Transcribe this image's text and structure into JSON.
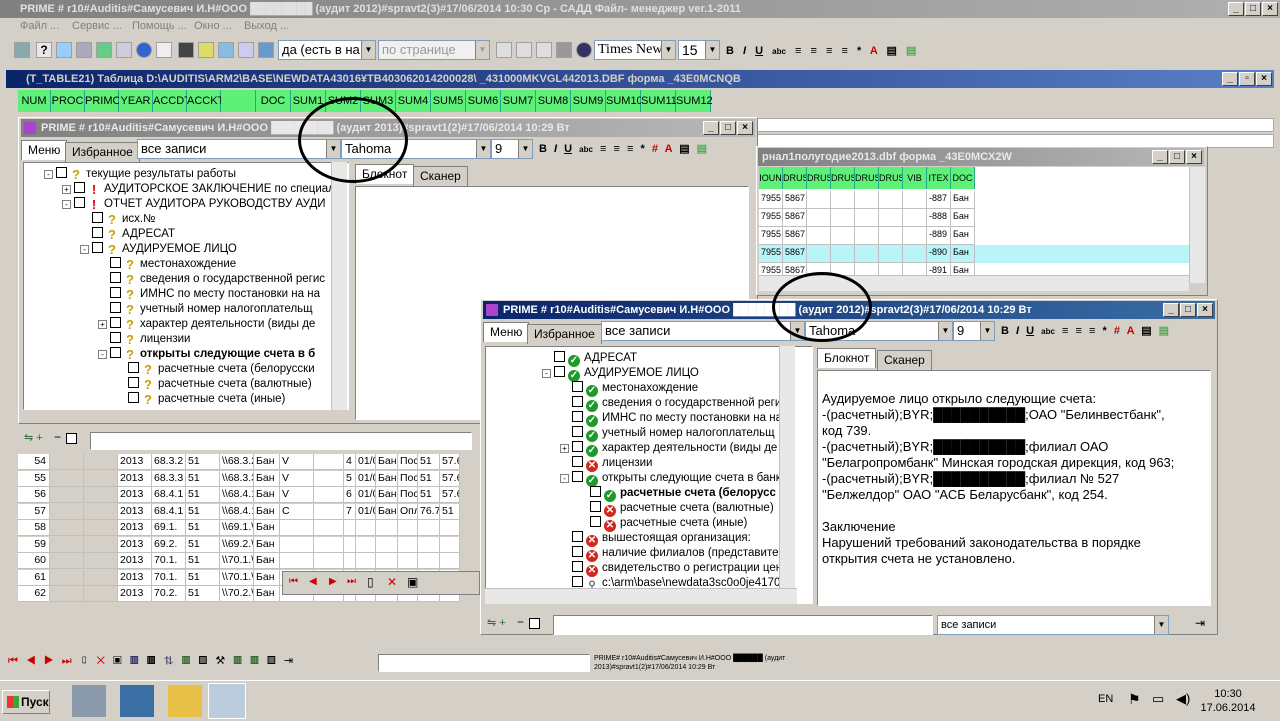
{
  "app": {
    "title": "PRIME # r10#Auditis#Самусевич И.Н#ООО ████████ (аудит 2012)#spravt2(3)#17/06/2014 10:30 Ср - САДД Файл- менеджер ver.1-2011",
    "menu": [
      "Файл ...",
      "Сервис ...",
      "Помощь ...",
      "Окно ...",
      "Выход ..."
    ],
    "toolbar": {
      "filter_value": "да (есть в на",
      "page_value": "по странице",
      "font": "Times New",
      "size": "15"
    }
  },
  "table_window": {
    "title": "(T_TABLE21) Таблица D:\\AUDITIS\\ARM2\\BASE\\NEWDATA43016¥TB403062014200028\\ _431000MKVGL442013.DBF форма _43E0MCNQB",
    "columns": [
      "NUM",
      "PROC",
      "PRIMO",
      "YEAR",
      "ACCDTID",
      "ACCKTIDR",
      "",
      "DOC",
      "SUM1",
      "SUM2",
      "SUM3",
      "SUM4",
      "SUM5",
      "SUM6",
      "SUM7",
      "SUM8",
      "SUM9",
      "SUM10",
      "SUM11",
      "SUM12"
    ],
    "rows": [
      [
        "54",
        "",
        "",
        "2013",
        "68.3.2",
        "51",
        "\\\\68.3.2",
        "Бан",
        "V",
        "",
        "4",
        "01/0",
        "Банк",
        "Пост",
        "51",
        "57.6"
      ],
      [
        "55",
        "",
        "",
        "2013",
        "68.3.3",
        "51",
        "\\\\68.3.3",
        "Бан",
        "V",
        "",
        "5",
        "01/0",
        "Банк",
        "Пост",
        "51",
        "57.6"
      ],
      [
        "56",
        "",
        "",
        "2013",
        "68.4.1",
        "51",
        "\\\\68.4.1",
        "Бан",
        "V",
        "",
        "6",
        "01/0",
        "Банк",
        "Пост",
        "51",
        "57.6"
      ],
      [
        "57",
        "",
        "",
        "2013",
        "68.4.1",
        "51",
        "\\\\68.4.1",
        "Бан",
        "С",
        "",
        "7",
        "01/0",
        "Банк",
        "Опла",
        "76.7",
        "51"
      ],
      [
        "58",
        "",
        "",
        "2013",
        "69.1.",
        "51",
        "\\\\69.1.\\\\",
        "Бан",
        "",
        "",
        "",
        "",
        "",
        "",
        "",
        ""
      ],
      [
        "59",
        "",
        "",
        "2013",
        "69.2.",
        "51",
        "\\\\69.2.\\\\",
        "Бан",
        "",
        "",
        "",
        "",
        "",
        "",
        "",
        ""
      ],
      [
        "60",
        "",
        "",
        "2013",
        "70.1.",
        "51",
        "\\\\70.1.\\\\",
        "Бан",
        "",
        "",
        "",
        "",
        "",
        "",
        "",
        ""
      ],
      [
        "61",
        "",
        "",
        "2013",
        "70.1.",
        "51",
        "\\\\70.1.\\\\",
        "Бан",
        "",
        "",
        "",
        "",
        "",
        "",
        "",
        ""
      ],
      [
        "62",
        "",
        "",
        "2013",
        "70.2.",
        "51",
        "\\\\70.2.\\\\",
        "Бан",
        "",
        "",
        "",
        "",
        "",
        "",
        "",
        ""
      ]
    ]
  },
  "win2013": {
    "title": "PRIME # r10#Auditis#Самусевич И.Н#ООО ████████ (аудит 2013)#spravt1(2)#17/06/2014 10:29 Вт",
    "tab_menu": "Меню",
    "tab_fav": "Избранное",
    "records": "все записи",
    "font": "Tahoma",
    "size": "9",
    "tab_notebook": "Блокнот",
    "tab_scanner": "Сканер",
    "tree": [
      {
        "t": "текущие результаты работы",
        "lvl": 0,
        "ico": "qm",
        "exp": "-"
      },
      {
        "t": "АУДИТОРСКОЕ ЗАКЛЮЧЕНИЕ по специал",
        "lvl": 1,
        "ico": "ex",
        "exp": "+"
      },
      {
        "t": "ОТЧЕТ АУДИТОРА РУКОВОДСТВУ АУДИ",
        "lvl": 1,
        "ico": "ex",
        "exp": "-"
      },
      {
        "t": "исх.№",
        "lvl": 2,
        "ico": "qm",
        "exp": ""
      },
      {
        "t": "АДРЕСАТ",
        "lvl": 2,
        "ico": "qm",
        "exp": ""
      },
      {
        "t": "АУДИРУЕМОЕ ЛИЦО",
        "lvl": 2,
        "ico": "qm",
        "exp": "-"
      },
      {
        "t": "местонахождение",
        "lvl": 3,
        "ico": "qm",
        "exp": ""
      },
      {
        "t": "сведения о государственной регис",
        "lvl": 3,
        "ico": "qm",
        "exp": ""
      },
      {
        "t": "ИМНС по месту постановки на на",
        "lvl": 3,
        "ico": "qm",
        "exp": ""
      },
      {
        "t": "учетный номер налогоплательщ",
        "lvl": 3,
        "ico": "qm",
        "exp": ""
      },
      {
        "t": "характер деятельности (виды де",
        "lvl": 3,
        "ico": "qm",
        "exp": "+"
      },
      {
        "t": "лицензии",
        "lvl": 3,
        "ico": "qm",
        "exp": ""
      },
      {
        "t": "открыты следующие счета в б",
        "lvl": 3,
        "ico": "qm",
        "exp": "-",
        "bold": true
      },
      {
        "t": "расчетные счета (белорусски",
        "lvl": 4,
        "ico": "qm",
        "exp": ""
      },
      {
        "t": "расчетные счета (валютные)",
        "lvl": 4,
        "ico": "qm",
        "exp": ""
      },
      {
        "t": "расчетные счета (иные)",
        "lvl": 4,
        "ico": "qm",
        "exp": ""
      }
    ]
  },
  "dbf_window": {
    "title": "рнал1полугодие2013.dbf форма _43E0MCX2W",
    "columns": [
      "IOUN",
      "DRUS",
      "DRUS",
      "DRUS",
      "DRUS",
      "DRUS",
      "VIB",
      "ITEX",
      "DOC"
    ],
    "rows": [
      [
        "7955",
        "5867",
        "",
        "",
        "",
        "",
        "",
        "-887",
        "Бан"
      ],
      [
        "7955",
        "5867",
        "",
        "",
        "",
        "",
        "",
        "-888",
        "Бан"
      ],
      [
        "7955",
        "5867",
        "",
        "",
        "",
        "",
        "",
        "-889",
        "Бан"
      ],
      [
        "7955",
        "5867",
        "",
        "",
        "",
        "",
        "",
        "-890",
        "Бан"
      ],
      [
        "7955",
        "5867",
        "",
        "",
        "",
        "",
        "",
        "-891",
        "Бан"
      ]
    ]
  },
  "win2012": {
    "title": "PRIME # r10#Auditis#Самусевич И.Н#ООО ████████ (аудит 2012)#spravt2(3)#17/06/2014 10:29 Вт",
    "tab_menu": "Меню",
    "tab_fav": "Избранное",
    "records": "все записи",
    "font": "Tahoma",
    "size": "9",
    "tab_notebook": "Блокнот",
    "tab_scanner": "Сканер",
    "tree": [
      {
        "t": "АДРЕСАТ",
        "lvl": 2,
        "ico": "ok",
        "exp": ""
      },
      {
        "t": "АУДИРУЕМОЕ ЛИЦО",
        "lvl": 2,
        "ico": "ok",
        "exp": "-"
      },
      {
        "t": "местонахождение",
        "lvl": 3,
        "ico": "ok",
        "exp": ""
      },
      {
        "t": "сведения о государственной регис",
        "lvl": 3,
        "ico": "ok",
        "exp": ""
      },
      {
        "t": "ИМНС по месту постановки на на",
        "lvl": 3,
        "ico": "ok",
        "exp": ""
      },
      {
        "t": "учетный номер налогоплательщ",
        "lvl": 3,
        "ico": "ok",
        "exp": ""
      },
      {
        "t": "характер деятельности (виды де",
        "lvl": 3,
        "ico": "ok",
        "exp": "+"
      },
      {
        "t": "лицензии",
        "lvl": 3,
        "ico": "err",
        "exp": ""
      },
      {
        "t": "открыты следующие счета в банк",
        "lvl": 3,
        "ico": "ok",
        "exp": "-"
      },
      {
        "t": "расчетные счета (белорусс",
        "lvl": 4,
        "ico": "ok",
        "exp": "",
        "bold": true
      },
      {
        "t": "расчетные счета (валютные)",
        "lvl": 4,
        "ico": "err",
        "exp": ""
      },
      {
        "t": "расчетные счета (иные)",
        "lvl": 4,
        "ico": "err",
        "exp": ""
      },
      {
        "t": "вышестоящая организация:",
        "lvl": 3,
        "ico": "err",
        "exp": ""
      },
      {
        "t": "наличие филиалов (представите",
        "lvl": 3,
        "ico": "err",
        "exp": ""
      },
      {
        "t": "свидетельство о регистрации цен",
        "lvl": 3,
        "ico": "err",
        "exp": ""
      },
      {
        "t": "c:\\arm\\base\\newdata3sc0o0je4170",
        "lvl": 3,
        "ico": "srch",
        "exp": ""
      }
    ],
    "notebook_text": [
      "Аудируемое лицо открыло следующие счета:",
      "-(расчетный);BYR;██████████;ОАО \"Белинвестбанк\",",
      "код 739.",
      "-(расчетный);BYR;██████████;филиал ОАО",
      "\"Белагропромбанк\" Минская городская дирекция, код 963;",
      "-(расчетный);BYR;██████████;филиал № 527",
      "\"Белжелдор\" ОАО \"АСБ Беларусбанк\", код 254.",
      "",
      "Заключение",
      "Нарушений требований законодательства в порядке",
      "открытия счета не установлено."
    ],
    "bottom_records": "все записи"
  },
  "statusbar": {
    "text1": "PRIME# r10#Auditis#Самусевич И.Н#ООО ██████ (аудит",
    "text2": "2013)#spravt1(2)#17/06/2014 10:29 Вт"
  },
  "taskbar": {
    "start": "Пуск",
    "lang": "EN",
    "time": "10:30",
    "date": "17.06.2014"
  }
}
